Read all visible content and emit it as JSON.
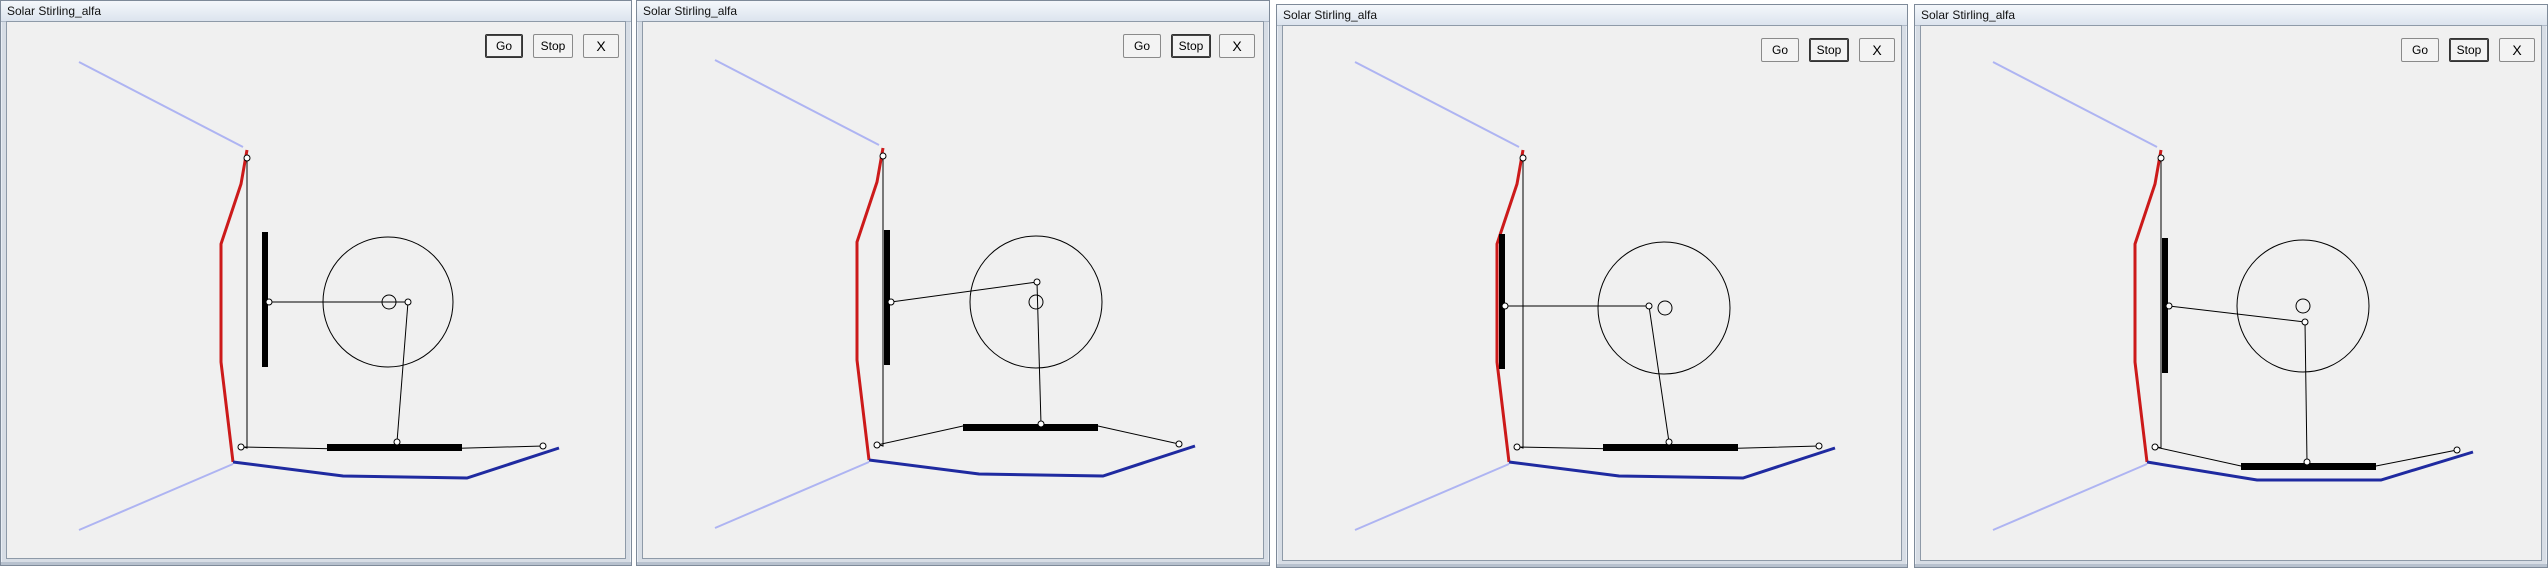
{
  "windows": [
    {
      "title": "Solar Stirling_alfa",
      "buttons": {
        "go": "Go",
        "stop": "Stop",
        "close": "X"
      },
      "pressed": "go"
    },
    {
      "title": "Solar Stirling_alfa",
      "buttons": {
        "go": "Go",
        "stop": "Stop",
        "close": "X"
      },
      "pressed": "stop"
    },
    {
      "title": "Solar Stirling_alfa",
      "buttons": {
        "go": "Go",
        "stop": "Stop",
        "close": "X"
      },
      "pressed": "stop"
    },
    {
      "title": "Solar Stirling_alfa",
      "buttons": {
        "go": "Go",
        "stop": "Stop",
        "close": "X"
      },
      "pressed": "stop"
    }
  ],
  "colors": {
    "light_ray": "#aeb4f2",
    "hot_mirror": "#cc1a1a",
    "cold_mirror": "#1f2aa0",
    "mechanism": "#000000"
  },
  "icons": {
    "close": "x-close-icon"
  }
}
